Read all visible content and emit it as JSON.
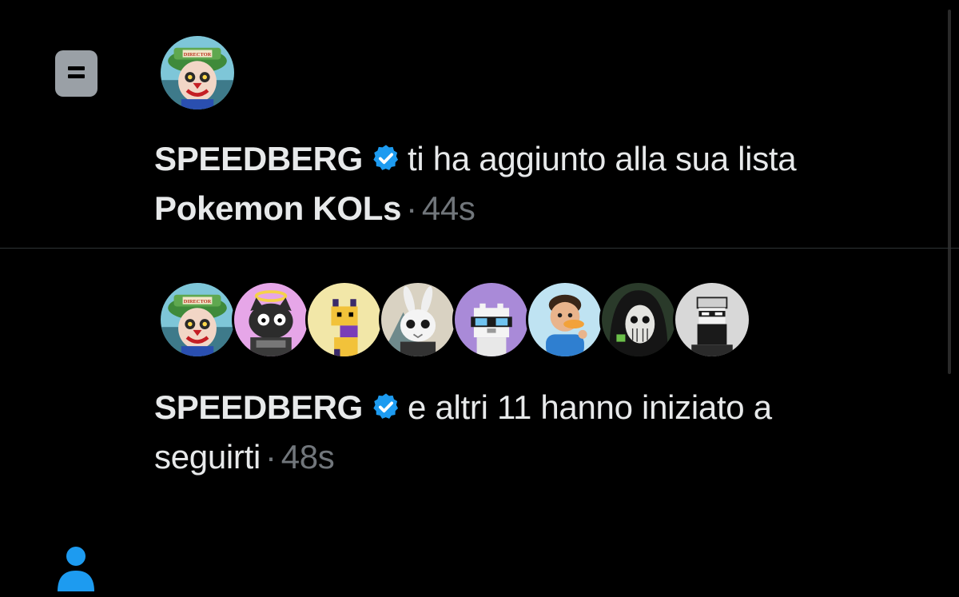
{
  "notifications": [
    {
      "type_icon": "list-icon",
      "user_name": "SPEEDBERG",
      "verified": true,
      "action_text": "ti ha aggiunto alla sua lista",
      "list_name": "Pokemon KOLs",
      "separator": "·",
      "time": "44s",
      "avatars": [
        "avatar-director"
      ]
    },
    {
      "type_icon": "person-icon",
      "user_name": "SPEEDBERG",
      "verified": true,
      "action_text": "e altri 11 hanno iniziato a",
      "action_text_2": "seguirti",
      "separator": "·",
      "time": "48s",
      "avatars": [
        "avatar-director",
        "avatar-angel-cat",
        "avatar-pixel-dog",
        "avatar-bunny",
        "avatar-pixel-bird",
        "avatar-cartoon-man",
        "avatar-hooded-face",
        "avatar-pixel-bearded"
      ]
    }
  ],
  "colors": {
    "background": "#000000",
    "text": "#e7e9ea",
    "muted": "#71767b",
    "verified": "#1d9bf0",
    "follow_icon": "#1d9bf0"
  }
}
